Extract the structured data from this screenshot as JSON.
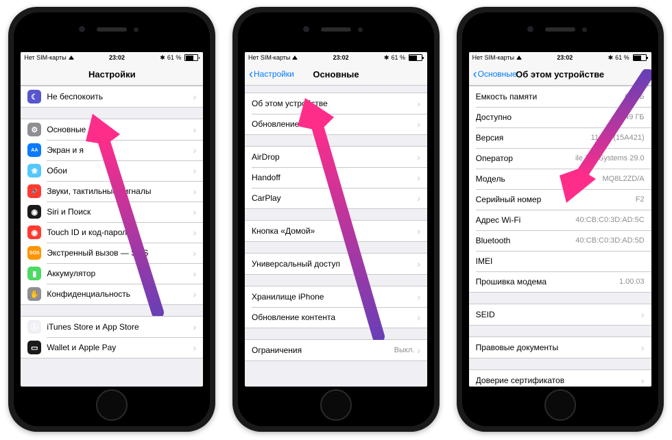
{
  "status": {
    "carrier": "Нет SIM-карты",
    "time": "23:02",
    "bluetooth": "*",
    "battery_pct": "61 %"
  },
  "phone1": {
    "title": "Настройки",
    "group1": [
      {
        "label": "Не беспокоить",
        "icon_bg": "#5756ce",
        "icon": "☾"
      }
    ],
    "group2": [
      {
        "label": "Основные",
        "icon_bg": "#8e8e93",
        "icon": "⚙"
      },
      {
        "label": "Экран и я",
        "icon_bg": "#0a7aff",
        "icon": "AA"
      },
      {
        "label": "Обои",
        "icon_bg": "#54c7fc",
        "icon": "❀"
      },
      {
        "label": "Звуки, тактильные сигналы",
        "icon_bg": "#ff3b30",
        "icon": "🔊"
      },
      {
        "label": "Siri и Поиск",
        "icon_bg": "#1a1a1a",
        "icon": "◉"
      },
      {
        "label": "Touch ID и код-пароль",
        "icon_bg": "#ff3b30",
        "icon": "◉"
      },
      {
        "label": "Экстренный вызов — SOS",
        "icon_bg": "#ff9500",
        "icon": "SOS"
      },
      {
        "label": "Аккумулятор",
        "icon_bg": "#4cd964",
        "icon": "▮"
      },
      {
        "label": "Конфиденциальность",
        "icon_bg": "#8e8e93",
        "icon": "✋"
      }
    ],
    "group3": [
      {
        "label": "iTunes Store и App Store",
        "icon_bg": "#efeff4",
        "icon": "Ⓐ"
      },
      {
        "label": "Wallet и Apple Pay",
        "icon_bg": "#1a1a1a",
        "icon": "▭"
      }
    ]
  },
  "phone2": {
    "back": "Настройки",
    "title": "Основные",
    "group1": [
      {
        "label": "Об этом устройстве"
      },
      {
        "label": "Обновление ПО"
      }
    ],
    "group2": [
      {
        "label": "AirDrop"
      },
      {
        "label": "Handoff"
      },
      {
        "label": "CarPlay"
      }
    ],
    "group3": [
      {
        "label": "Кнопка «Домой»"
      }
    ],
    "group4": [
      {
        "label": "Универсальный доступ"
      }
    ],
    "group5": [
      {
        "label": "Хранилище iPhone"
      },
      {
        "label": "Обновление контента"
      }
    ],
    "group6": [
      {
        "label": "Ограничения",
        "value": "Выкл."
      }
    ]
  },
  "phone3": {
    "back": "Основные",
    "title": "Об этом устройстве",
    "group1": [
      {
        "label": "Емкость памяти",
        "value": "64 ГБ"
      },
      {
        "label": "Доступно",
        "value": "54,49 ГБ"
      },
      {
        "label": "Версия",
        "value": "11.0.2 (15A421)"
      },
      {
        "label": "Оператор",
        "value": "ile TeleSystems 29.0"
      },
      {
        "label": "Модель",
        "value": "MQ8L2ZD/A"
      },
      {
        "label": "Серийный номер",
        "value": "F2"
      },
      {
        "label": "Адрес Wi-Fi",
        "value": "40:CB:C0:3D:AD:5C"
      },
      {
        "label": "Bluetooth",
        "value": "40:CB:C0:3D:AD:5D"
      },
      {
        "label": "IMEI",
        "value": ""
      },
      {
        "label": "Прошивка модема",
        "value": "1.00.03"
      }
    ],
    "group2": [
      {
        "label": "SEID",
        "chevron": true
      }
    ],
    "group3": [
      {
        "label": "Правовые документы",
        "chevron": true
      }
    ],
    "group4": [
      {
        "label": "Доверие сертификатов",
        "chevron": true
      }
    ]
  }
}
